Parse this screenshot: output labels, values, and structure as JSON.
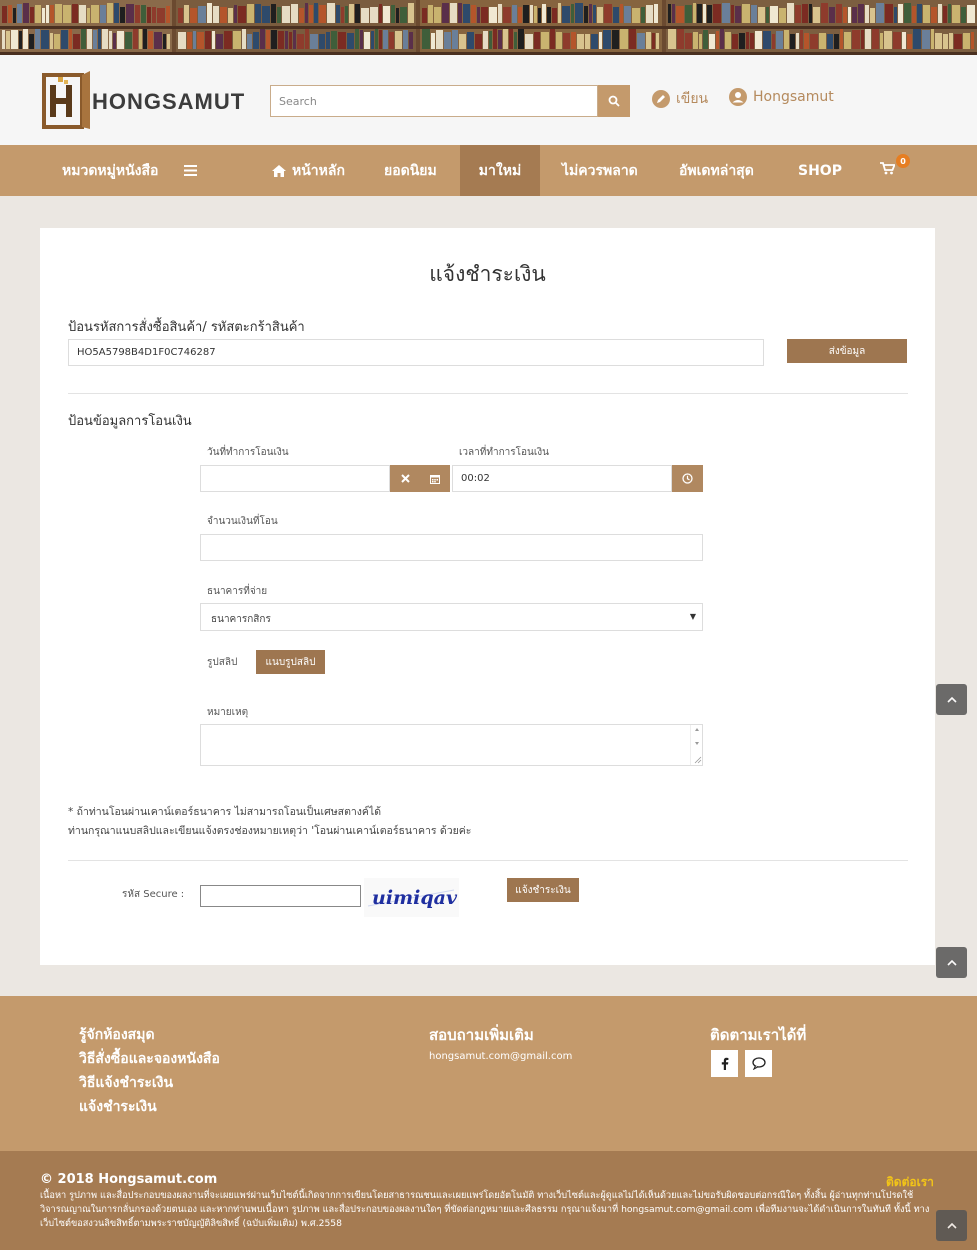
{
  "colors": {
    "brand": "#c49a6c",
    "brand_dark": "#a57b52",
    "button": "#9e7650",
    "accent": "#e67e22",
    "contact": "#f2c418"
  },
  "header": {
    "logo_text": "HONGSAMUT",
    "search_placeholder": "Search",
    "write_label": "เขียน",
    "user_label": "Hongsamut"
  },
  "nav": {
    "categories": "หมวดหมู่หนังสือ",
    "home": "หน้าหลัก",
    "popular": "ยอดนิยม",
    "new": "มาใหม่",
    "dont_miss": "ไม่ควรพลาด",
    "latest": "อัพเดทล่าสุด",
    "shop": "SHOP",
    "cart_count": "0"
  },
  "form": {
    "title": "แจ้งชำระเงิน",
    "order_label": "ป้อนรหัสการสั่งซื้อสินค้า/ รหัสตะกร้าสินค้า",
    "order_value": "HO5A5798B4D1F0C746287",
    "submit_order": "ส่งข้อมูล",
    "transfer_label": "ป้อนข้อมูลการโอนเงิน",
    "date_label": "วันที่ทำการโอนเงิน",
    "date_value": "",
    "time_label": "เวลาที่ทำการโอนเงิน",
    "time_value": "00:02",
    "amount_label": "จำนวนเงินที่โอน",
    "bank_label": "ธนาคารที่จ่าย",
    "bank_value": "ธนาคารกสิกร",
    "slip_label": "รูปสลิป",
    "slip_button": "แนบรูปสลิป",
    "remark_label": "หมายเหตุ",
    "note_line1": "* ถ้าท่านโอนผ่านเคาน์เตอร์ธนาคาร ไม่สามารถโอนเป็นเศษสตางค์ได้",
    "note_line2": "ท่านกรุณาแนบสลิปและเขียนแจ้งตรงช่องหมายเหตุว่า 'โอนผ่านเคาน์เตอร์ธนาคาร ด้วยค่ะ",
    "secure_label": "รหัส Secure :",
    "captcha_text": "uimiqav",
    "submit_payment": "แจ้งชำระเงิน"
  },
  "footer": {
    "links": [
      "รู้จักห้องสมุด",
      "วิธีสั่งซื้อและจองหนังสือ",
      "วิธีแจ้งชำระเงิน",
      "แจ้งชำระเงิน"
    ],
    "contact_head": "สอบถามเพิ่มเติม",
    "email": "hongsamut.com@gmail.com",
    "follow_head": "ติดตามเราได้ที่",
    "copyright": "© 2018 Hongsamut.com",
    "contact_link": "ติดต่อเรา",
    "disclaimer": "เนื้อหา รูปภาพ และสื่อประกอบของผลงานที่จะเผยแพร่ผ่านเว็บไซต์นี้เกิดจากการเขียนโดยสาธารณชนและเผยแพร่โดยอัตโนมัติ ทางเว็บไซต์และผู้ดูแลไม่ได้เห็นด้วยและไม่ขอรับผิดชอบต่อกรณีใดๆ ทั้งสิ้น ผู้อ่านทุกท่านโปรดใช้วิจารณญาณในการกลั่นกรองด้วยตนเอง และหากท่านพบเนื้อหา รูปภาพ และสื่อประกอบของผลงานใดๆ ที่ขัดต่อกฎหมายและศีลธรรม กรุณาแจ้งมาที่ hongsamut.com@gmail.com เพื่อทีมงานจะได้ดำเนินการในทันที ทั้งนี้ ทางเว็บไซต์ขอสงวนลิขสิทธิ์ตามพระราชบัญญัติลิขสิทธิ์ (ฉบับเพิ่มเติม) พ.ศ.2558"
  }
}
